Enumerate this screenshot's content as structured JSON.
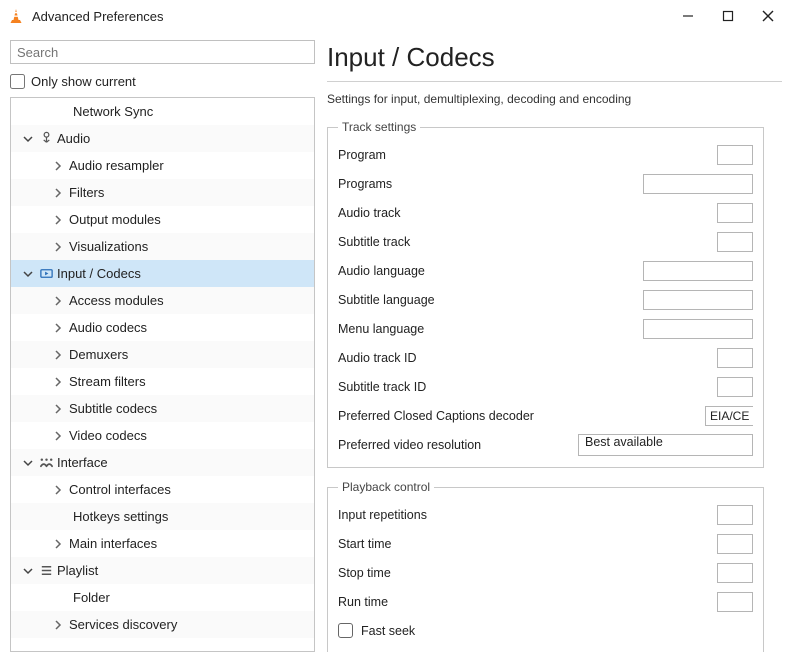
{
  "window": {
    "title": "Advanced Preferences"
  },
  "sidebar": {
    "search_placeholder": "Search",
    "only_current_label": "Only show current",
    "tree": [
      {
        "label": "Network Sync",
        "level": 2,
        "leaf": true
      },
      {
        "label": "Audio",
        "level": 1,
        "expanded": true,
        "icon": "audio"
      },
      {
        "label": "Audio resampler",
        "level": 2,
        "collapsible": true
      },
      {
        "label": "Filters",
        "level": 2,
        "collapsible": true
      },
      {
        "label": "Output modules",
        "level": 2,
        "collapsible": true
      },
      {
        "label": "Visualizations",
        "level": 2,
        "collapsible": true
      },
      {
        "label": "Input / Codecs",
        "level": 1,
        "expanded": true,
        "icon": "codec",
        "selected": true
      },
      {
        "label": "Access modules",
        "level": 2,
        "collapsible": true
      },
      {
        "label": "Audio codecs",
        "level": 2,
        "collapsible": true
      },
      {
        "label": "Demuxers",
        "level": 2,
        "collapsible": true
      },
      {
        "label": "Stream filters",
        "level": 2,
        "collapsible": true
      },
      {
        "label": "Subtitle codecs",
        "level": 2,
        "collapsible": true
      },
      {
        "label": "Video codecs",
        "level": 2,
        "collapsible": true
      },
      {
        "label": "Interface",
        "level": 1,
        "expanded": true,
        "icon": "interface"
      },
      {
        "label": "Control interfaces",
        "level": 2,
        "collapsible": true
      },
      {
        "label": "Hotkeys settings",
        "level": 2,
        "leaf": true
      },
      {
        "label": "Main interfaces",
        "level": 2,
        "collapsible": true
      },
      {
        "label": "Playlist",
        "level": 1,
        "expanded": true,
        "icon": "playlist"
      },
      {
        "label": "Folder",
        "level": 2,
        "leaf": true
      },
      {
        "label": "Services discovery",
        "level": 2,
        "collapsible": true
      }
    ]
  },
  "main": {
    "title": "Input / Codecs",
    "description": "Settings for input, demultiplexing, decoding and encoding",
    "groups": [
      {
        "legend": "Track settings",
        "fields": [
          {
            "label": "Program",
            "type": "spin"
          },
          {
            "label": "Programs",
            "type": "textwide"
          },
          {
            "label": "Audio track",
            "type": "spin"
          },
          {
            "label": "Subtitle track",
            "type": "spin"
          },
          {
            "label": "Audio language",
            "type": "textwide"
          },
          {
            "label": "Subtitle language",
            "type": "textwide"
          },
          {
            "label": "Menu language",
            "type": "textwide"
          },
          {
            "label": "Audio track ID",
            "type": "spin"
          },
          {
            "label": "Subtitle track ID",
            "type": "spin"
          },
          {
            "label": "Preferred Closed Captions decoder",
            "type": "trunc",
            "value": "EIA/CE"
          },
          {
            "label": "Preferred video resolution",
            "type": "select",
            "value": "Best available"
          }
        ]
      },
      {
        "legend": "Playback control",
        "fields": [
          {
            "label": "Input repetitions",
            "type": "spin"
          },
          {
            "label": "Start time",
            "type": "spin"
          },
          {
            "label": "Stop time",
            "type": "spin"
          },
          {
            "label": "Run time",
            "type": "spin"
          },
          {
            "label": "Fast seek",
            "type": "check"
          }
        ]
      }
    ]
  }
}
